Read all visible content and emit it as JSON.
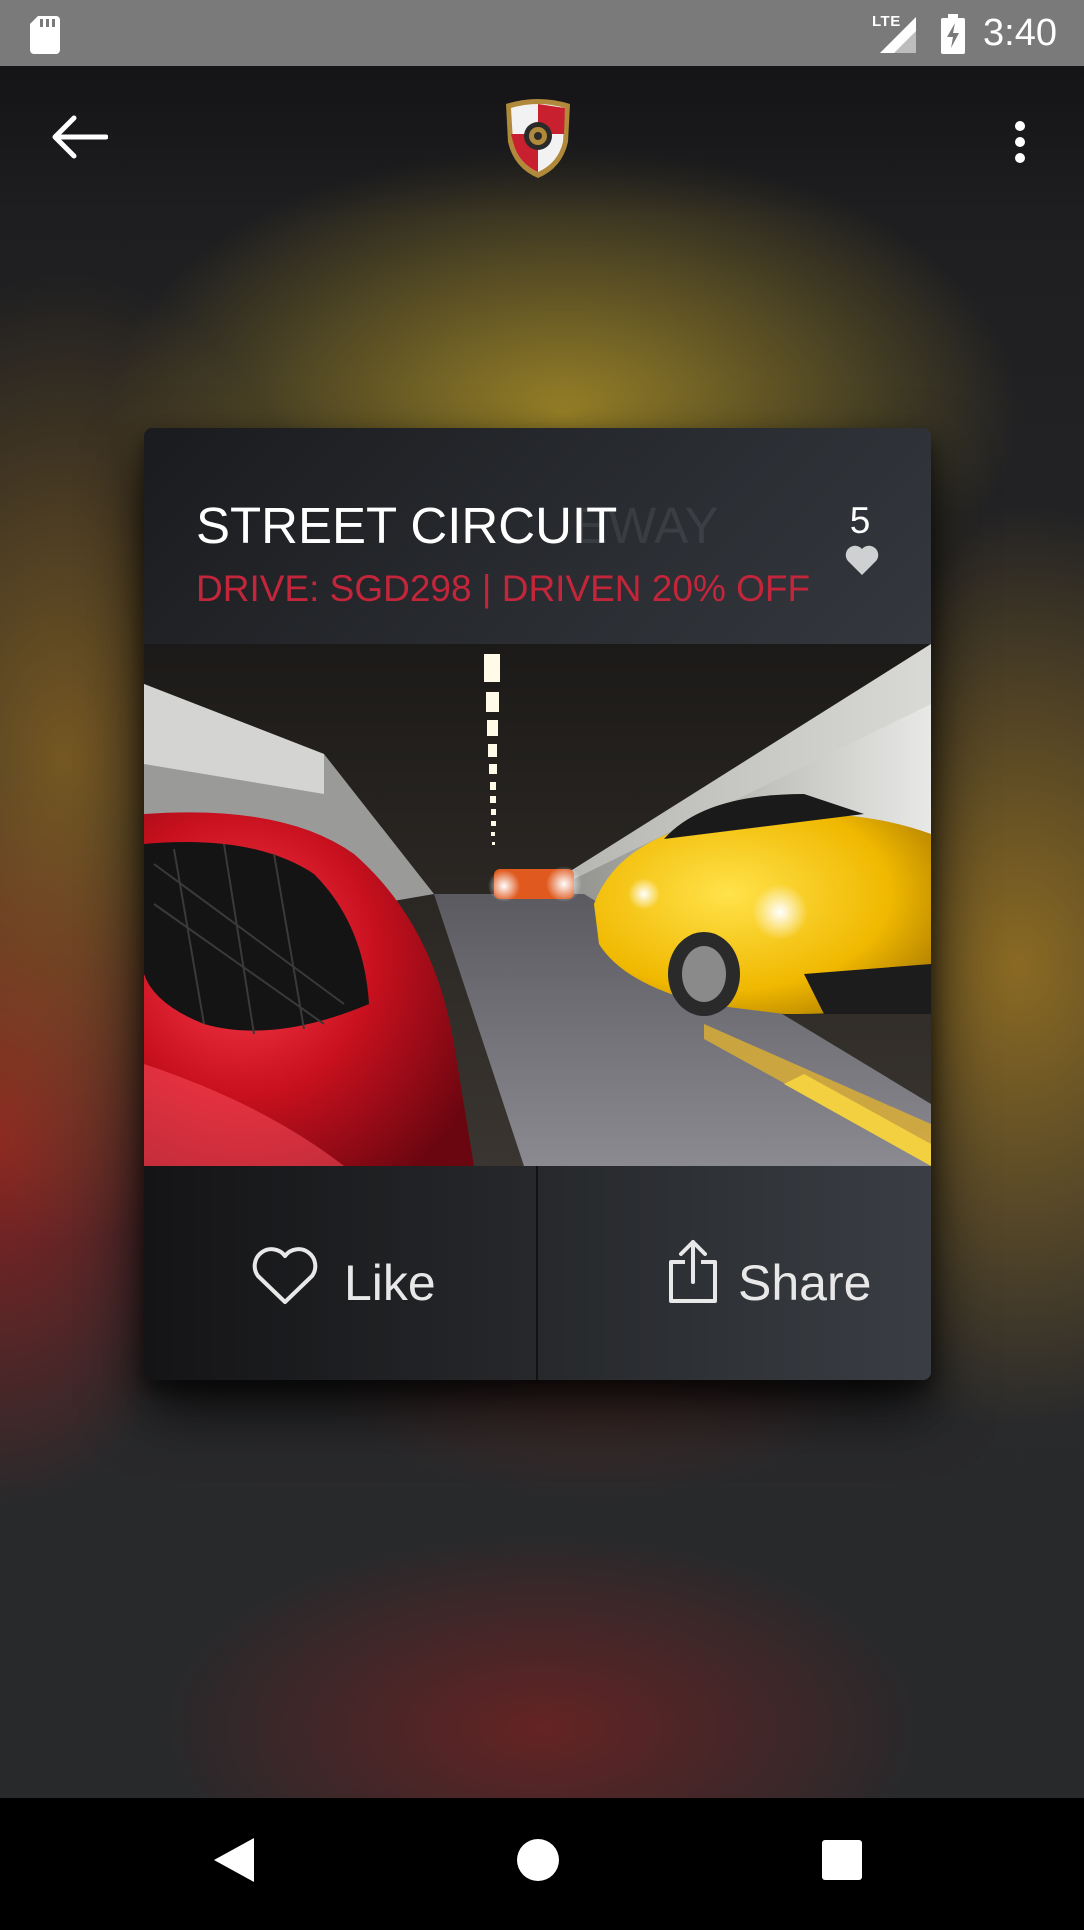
{
  "status_bar": {
    "network_label": "LTE",
    "time": "3:40",
    "icons": [
      "sd-card-icon",
      "signal-icon",
      "battery-charging-icon"
    ]
  },
  "toolbar": {
    "icons": [
      "back-arrow-icon",
      "app-logo-shield",
      "overflow-menu-icon"
    ]
  },
  "card": {
    "title": "STREET CIRCUIT",
    "ghost_text": "EWAY",
    "subtitle": "DRIVE: SGD298 | DRIVEN 20% OFF",
    "like_count": "5",
    "image_description_icon": "car-photo",
    "actions": {
      "like_label": "Like",
      "share_label": "Share"
    }
  },
  "nav_bar": {
    "icons": [
      "nav-back-icon",
      "nav-home-icon",
      "nav-recents-icon"
    ]
  },
  "colors": {
    "accent_red": "#c3263a",
    "status_bar": "#7a7a7a",
    "nav_bar": "#000000"
  }
}
